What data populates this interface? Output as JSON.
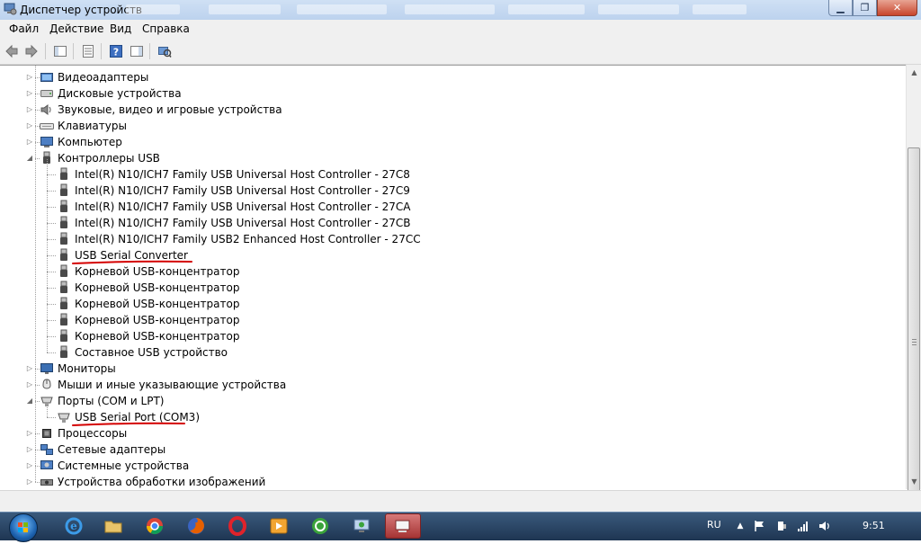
{
  "window": {
    "title": "Диспетчер устройств",
    "min_label": "▁",
    "restore_label": "❐",
    "close_label": "✕"
  },
  "menu": [
    "Файл",
    "Действие",
    "Вид",
    "Справка"
  ],
  "toolbar": {
    "buttons": [
      "back-icon",
      "forward-icon",
      "show-hide-console-tree-icon",
      "properties-icon",
      "help-icon",
      "show-action-pane-icon",
      "scan-hardware-icon"
    ]
  },
  "tree": {
    "categories": [
      {
        "label": "Видеоадаптеры",
        "icon": "display-adapter-icon",
        "expanded": false
      },
      {
        "label": "Дисковые устройства",
        "icon": "disk-drive-icon",
        "expanded": false
      },
      {
        "label": "Звуковые, видео и игровые устройства",
        "icon": "sound-icon",
        "expanded": false
      },
      {
        "label": "Клавиатуры",
        "icon": "keyboard-icon",
        "expanded": false
      },
      {
        "label": "Компьютер",
        "icon": "computer-icon",
        "expanded": false
      },
      {
        "label": "Контроллеры USB",
        "icon": "usb-icon",
        "expanded": true,
        "children": [
          "Intel(R) N10/ICH7 Family USB Universal Host Controller - 27C8",
          "Intel(R) N10/ICH7 Family USB Universal Host Controller - 27C9",
          "Intel(R) N10/ICH7 Family USB Universal Host Controller - 27CA",
          "Intel(R) N10/ICH7 Family USB Universal Host Controller - 27CB",
          "Intel(R) N10/ICH7 Family USB2 Enhanced Host Controller - 27CC",
          "USB Serial Converter",
          "Корневой USB-концентратор",
          "Корневой USB-концентратор",
          "Корневой USB-концентратор",
          "Корневой USB-концентратор",
          "Корневой USB-концентратор",
          "Составное USB устройство"
        ]
      },
      {
        "label": "Мониторы",
        "icon": "monitor-icon",
        "expanded": false
      },
      {
        "label": "Мыши и иные указывающие устройства",
        "icon": "mouse-icon",
        "expanded": false
      },
      {
        "label": "Порты (COM и LPT)",
        "icon": "port-icon",
        "expanded": true,
        "children": [
          "USB Serial Port (COM3)"
        ]
      },
      {
        "label": "Процессоры",
        "icon": "processor-icon",
        "expanded": false
      },
      {
        "label": "Сетевые адаптеры",
        "icon": "network-adapter-icon",
        "expanded": false
      },
      {
        "label": "Системные устройства",
        "icon": "system-device-icon",
        "expanded": false
      },
      {
        "label": "Устройства обработки изображений",
        "icon": "imaging-device-icon",
        "expanded": false
      }
    ]
  },
  "annotations": {
    "underline_color": "#d40000"
  },
  "taskbar": {
    "apps": [
      "internet-explorer-icon",
      "explorer-folder-icon",
      "chrome-icon",
      "firefox-icon",
      "opera-icon",
      "media-player-icon",
      "green-app-icon",
      "network-app-icon",
      "device-manager-icon"
    ],
    "language": "RU",
    "clock": "9:51"
  }
}
